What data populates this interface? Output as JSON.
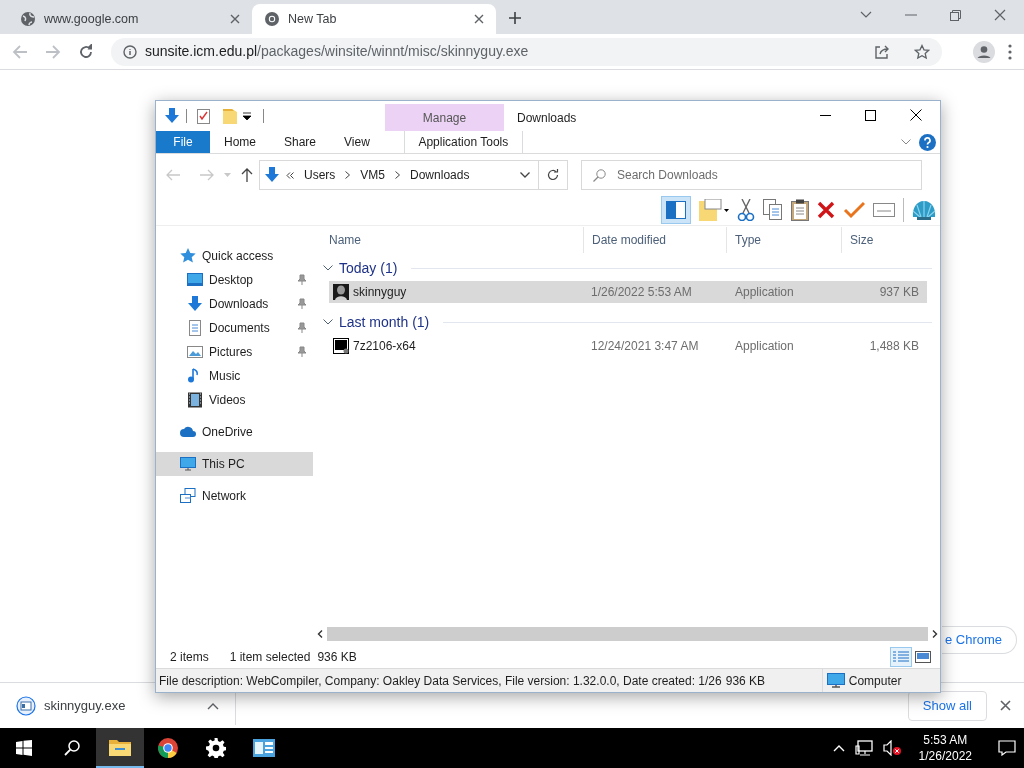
{
  "browser": {
    "tabs": [
      {
        "title": "www.google.com",
        "selected": false
      },
      {
        "title": "New Tab",
        "selected": true
      }
    ],
    "address": {
      "host": "sunsite.icm.edu.pl",
      "path": "/packages/winsite/winnt/misc/skinnyguy.exe"
    },
    "background_button": "e Chrome",
    "download_shelf": {
      "file": "skinnyguy.exe",
      "show_all": "Show all"
    }
  },
  "explorer": {
    "title": "Downloads",
    "context_group": "Manage",
    "ribbon_tabs": [
      {
        "label": "File",
        "kind": "file"
      },
      {
        "label": "Home",
        "kind": "tab"
      },
      {
        "label": "Share",
        "kind": "tab"
      },
      {
        "label": "View",
        "kind": "tab"
      },
      {
        "label": "Application Tools",
        "kind": "context"
      }
    ],
    "breadcrumb": [
      "Users",
      "VM5",
      "Downloads"
    ],
    "search": {
      "placeholder": "Search Downloads"
    },
    "nav": [
      {
        "label": "Quick access",
        "selected": false,
        "children": [
          {
            "label": "Desktop",
            "pinned": true,
            "selected": false
          },
          {
            "label": "Downloads",
            "pinned": true,
            "selected": false
          },
          {
            "label": "Documents",
            "pinned": true,
            "selected": false
          },
          {
            "label": "Pictures",
            "pinned": true,
            "selected": false
          },
          {
            "label": "Music",
            "pinned": false,
            "selected": false
          },
          {
            "label": "Videos",
            "pinned": false,
            "selected": false
          }
        ]
      },
      {
        "label": "OneDrive",
        "selected": false
      },
      {
        "label": "This PC",
        "selected": true
      },
      {
        "label": "Network",
        "selected": false
      }
    ],
    "columns": [
      "Name",
      "Date modified",
      "Type",
      "Size"
    ],
    "groups": [
      {
        "label": "Today (1)",
        "files": [
          {
            "name": "skinnyguy",
            "date": "1/26/2022 5:53 AM",
            "type": "Application",
            "size": "937 KB",
            "selected": true
          }
        ]
      },
      {
        "label": "Last month (1)",
        "files": [
          {
            "name": "7z2106-x64",
            "date": "12/24/2021 3:47 AM",
            "type": "Application",
            "size": "1,488 KB",
            "selected": false
          }
        ]
      }
    ],
    "status": {
      "count": "2 items",
      "selection": "1 item selected",
      "size": "936 KB"
    },
    "details_bar": {
      "description": "File description: WebCompiler, Company: Oakley Data Services, File version: 1.32.0.0, Date created: 1/26",
      "size": "936 KB",
      "location": "Computer"
    }
  },
  "taskbar": {
    "time": "5:53 AM",
    "date": "1/26/2022"
  }
}
